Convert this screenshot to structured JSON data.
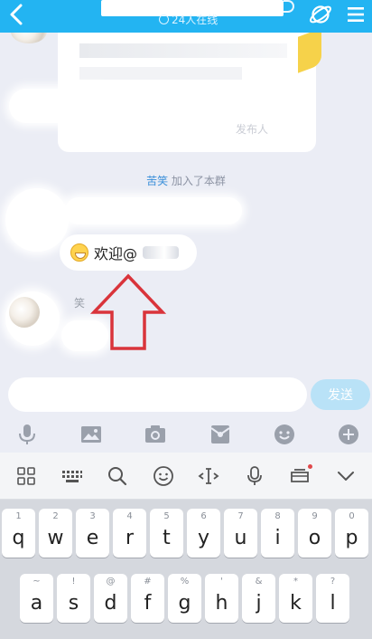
{
  "header": {
    "subtitle": "24人在线",
    "back_icon": "chevron-left-icon",
    "right_icons": [
      "planet-icon",
      "menu-icon"
    ],
    "background": "#23b4f2"
  },
  "chat": {
    "bubble_1_visible_text": "发布人",
    "system_notice": {
      "name": "苦笑",
      "action": "加入了本群"
    },
    "welcome_message": "欢迎@",
    "third_sender": "笑"
  },
  "input": {
    "placeholder": "",
    "send_label": "发送"
  },
  "toolbar": [
    "microphone-icon",
    "image-icon",
    "camera-icon",
    "red-packet-icon",
    "emoji-icon",
    "plus-icon"
  ],
  "keyboard": {
    "toolbar": [
      "grid-icon",
      "keyboard-icon",
      "search-icon",
      "smiley-icon",
      "cursor-icon",
      "microphone-icon",
      "clipboard-icon",
      "chevron-down-icon"
    ],
    "row1": [
      {
        "k": "q",
        "s": "1"
      },
      {
        "k": "w",
        "s": "2"
      },
      {
        "k": "e",
        "s": "3"
      },
      {
        "k": "r",
        "s": "4"
      },
      {
        "k": "t",
        "s": "5"
      },
      {
        "k": "y",
        "s": "6"
      },
      {
        "k": "u",
        "s": "7"
      },
      {
        "k": "i",
        "s": "8"
      },
      {
        "k": "o",
        "s": "9"
      },
      {
        "k": "p",
        "s": "0"
      }
    ],
    "row2": [
      {
        "k": "a",
        "s": "~"
      },
      {
        "k": "s",
        "s": "!"
      },
      {
        "k": "d",
        "s": "@"
      },
      {
        "k": "f",
        "s": "#"
      },
      {
        "k": "g",
        "s": "%"
      },
      {
        "k": "h",
        "s": "'"
      },
      {
        "k": "j",
        "s": "&"
      },
      {
        "k": "k",
        "s": "*"
      },
      {
        "k": "l",
        "s": "?"
      }
    ]
  }
}
